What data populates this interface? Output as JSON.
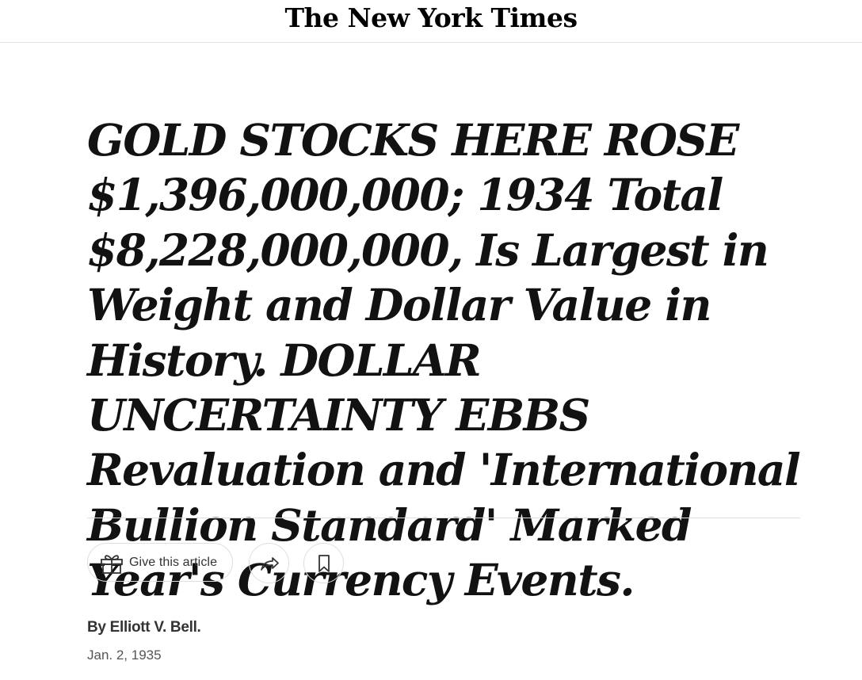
{
  "masthead": {
    "logo_text": "The New York Times"
  },
  "article": {
    "headline": "GOLD STOCKS HERE ROSE $1,396,000,000; 1934 Total $8,228,000,000, Is Largest in Weight and Dollar Value in History. DOLLAR UNCERTAINTY EBBS Revaluation and 'International Bullion Standard' Marked Year's Currency Events.",
    "byline": "By Elliott V. Bell.",
    "date": "Jan. 2, 1935"
  },
  "share_tools": {
    "give_label": "Give this article",
    "give_icon": "gift-icon",
    "share_icon": "share-arrow-icon",
    "save_icon": "bookmark-icon"
  }
}
